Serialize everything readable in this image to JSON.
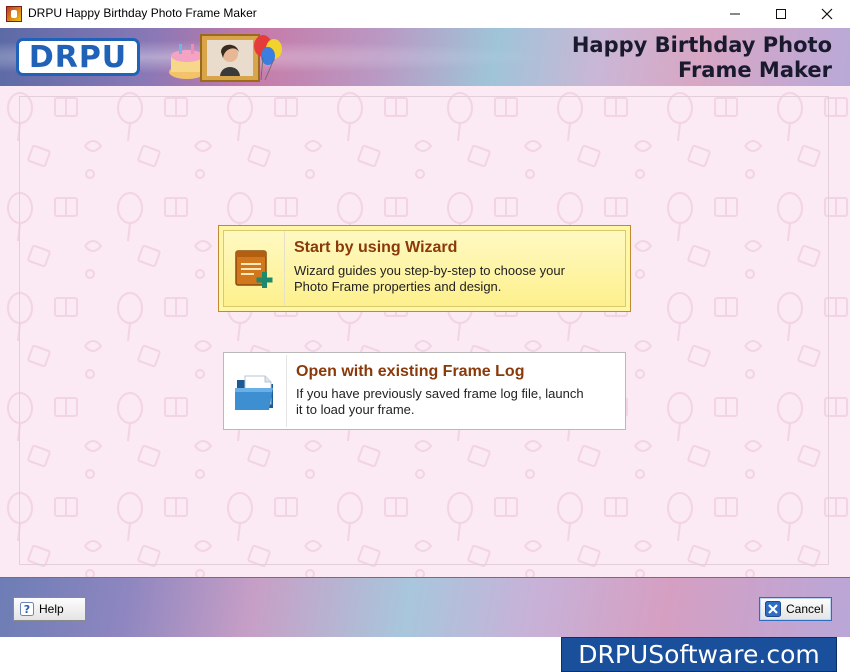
{
  "window": {
    "title": "DRPU Happy Birthday Photo Frame Maker",
    "controls": {
      "minimize": "—",
      "maximize": "☐",
      "close": "✕"
    }
  },
  "header": {
    "logo": "DRPU",
    "title_line1": "Happy Birthday Photo",
    "title_line2": "Frame Maker"
  },
  "options": [
    {
      "title": "Start by using Wizard",
      "desc_line1": "Wizard guides you step-by-step to choose your",
      "desc_line2": "Photo Frame properties and design.",
      "icon": "wizard-document-plus-icon",
      "state": "selected"
    },
    {
      "title": "Open with existing Frame Log",
      "desc_line1": "If you have previously saved frame log file, launch",
      "desc_line2": "it to load your frame.",
      "icon": "open-folder-icon",
      "state": "normal"
    }
  ],
  "footer": {
    "help_label": "Help",
    "cancel_label": "Cancel",
    "brand": "DRPUSoftware.com"
  },
  "colors": {
    "accent_blue": "#1f62b8",
    "card_title": "#8a3a0a",
    "selected_card": "#fff6a6",
    "main_bg": "#fbe9f3"
  }
}
